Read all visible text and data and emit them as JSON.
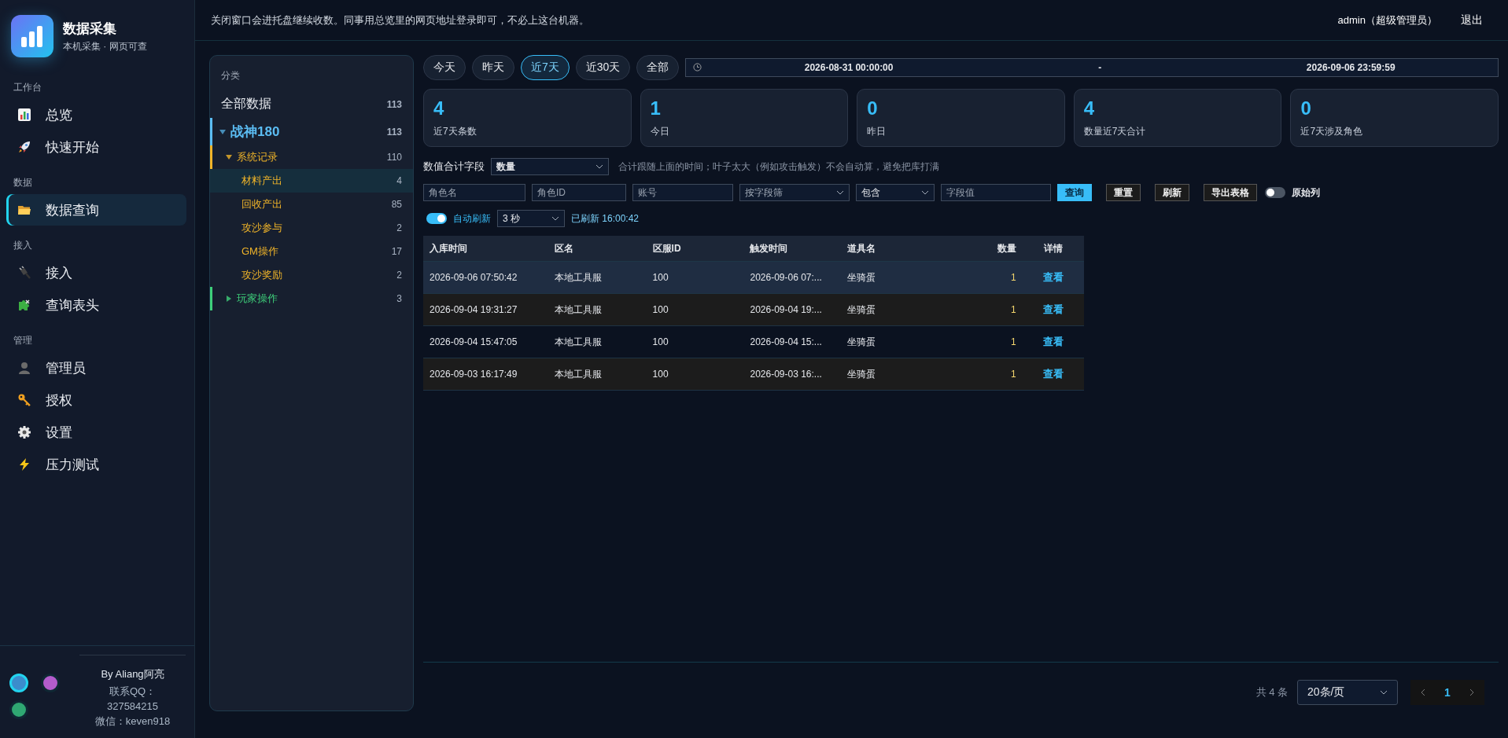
{
  "brand": {
    "title": "数据采集",
    "subtitle": "本机采集 · 网页可查"
  },
  "nav": [
    {
      "section": "工作台",
      "items": [
        {
          "label": "总览",
          "selected": false
        },
        {
          "label": "快速开始",
          "selected": false
        }
      ]
    },
    {
      "section": "数据",
      "items": [
        {
          "label": "数据查询",
          "selected": true
        }
      ]
    },
    {
      "section": "接入",
      "items": [
        {
          "label": "接入",
          "selected": false
        },
        {
          "label": "查询表头",
          "selected": false
        }
      ]
    },
    {
      "section": "管理",
      "items": [
        {
          "label": "管理员",
          "selected": false
        },
        {
          "label": "授权",
          "selected": false
        },
        {
          "label": "设置",
          "selected": false
        },
        {
          "label": "压力测试",
          "selected": false
        }
      ]
    }
  ],
  "themes": [
    {
      "color": "#3b8ccc",
      "selected": true
    },
    {
      "color": "#b35ccc",
      "selected": false
    },
    {
      "color": "#2fa872",
      "selected": false
    }
  ],
  "credits": {
    "author": "By Aliang阿亮",
    "contact_label": "联系QQ：",
    "qq": "327584215",
    "wechat": "微信：keven918"
  },
  "topbar": {
    "notice": "关闭窗口会进托盘继续收数。同事用总览里的网页地址登录即可，不必上这台机器。",
    "user": "admin（超级管理员）",
    "logout": "退出"
  },
  "categories": {
    "title": "分类",
    "items": [
      {
        "label": "全部数据",
        "count": "113",
        "selected": false
      },
      {
        "label": "战神180",
        "count": "113",
        "selected": false,
        "expanded": true,
        "color": "#5bbcf2",
        "children": [
          {
            "label": "系统记录",
            "count": "110",
            "selected": false,
            "expanded": true,
            "color": "#f0b429",
            "children": [
              {
                "label": "材料产出",
                "count": "4",
                "selected": true
              },
              {
                "label": "回收产出",
                "count": "85",
                "selected": false
              },
              {
                "label": "攻沙参与",
                "count": "2",
                "selected": false
              },
              {
                "label": "GM操作",
                "count": "17",
                "selected": false
              },
              {
                "label": "攻沙奖励",
                "count": "2",
                "selected": false
              }
            ]
          },
          {
            "label": "玩家操作",
            "count": "3",
            "selected": false,
            "expanded": false,
            "color": "#3ecf7a"
          }
        ]
      }
    ]
  },
  "date_presets": [
    {
      "label": "今天",
      "selected": false
    },
    {
      "label": "昨天",
      "selected": false
    },
    {
      "label": "近7天",
      "selected": true
    },
    {
      "label": "近30天",
      "selected": false
    },
    {
      "label": "全部",
      "selected": false
    }
  ],
  "date_range": {
    "start": "2026-08-31 00:00:00",
    "separator": "-",
    "end": "2026-09-06 23:59:59"
  },
  "stats": [
    {
      "value": "4",
      "label": "近7天条数"
    },
    {
      "value": "1",
      "label": "今日"
    },
    {
      "value": "0",
      "label": "昨日"
    },
    {
      "value": "4",
      "label": "数量近7天合计"
    },
    {
      "value": "0",
      "label": "近7天涉及角色"
    }
  ],
  "sum_field": {
    "label": "数值合计字段",
    "value": "数量",
    "hint": "合计跟随上面的时间；叶子太大（例如攻击触发）不会自动算，避免把库打满"
  },
  "filters": [
    {
      "kind": "input",
      "placeholder": "角色名"
    },
    {
      "kind": "input",
      "placeholder": "角色ID"
    },
    {
      "kind": "input",
      "placeholder": "账号"
    },
    {
      "kind": "select",
      "placeholder": "按字段筛"
    },
    {
      "kind": "select",
      "value": "包含"
    },
    {
      "kind": "input",
      "placeholder": "字段值"
    },
    {
      "kind": "button",
      "label": "查询",
      "primary": true
    },
    {
      "kind": "button",
      "label": "重置",
      "primary": false
    },
    {
      "kind": "button",
      "label": "刷新",
      "primary": false
    },
    {
      "kind": "button",
      "label": "导出表格",
      "primary": false
    },
    {
      "kind": "toggle",
      "label": "原始列",
      "on": false
    }
  ],
  "auto_refresh": {
    "label": "自动刷新",
    "on": true,
    "interval": "3 秒",
    "status": "已刷新 16:00:42"
  },
  "table": {
    "columns": [
      "入库时间",
      "区名",
      "区服ID",
      "触发时间",
      "道具名",
      "数量",
      "详情"
    ],
    "rows": [
      {
        "cells": [
          "2026-09-06 07:50:42",
          "本地工具服",
          "100",
          "2026-09-06 07:...",
          "坐骑蛋",
          "1"
        ],
        "action": "查看",
        "selected": true
      },
      {
        "cells": [
          "2026-09-04 19:31:27",
          "本地工具服",
          "100",
          "2026-09-04 19:...",
          "坐骑蛋",
          "1"
        ],
        "action": "查看",
        "selected": false
      },
      {
        "cells": [
          "2026-09-04 15:47:05",
          "本地工具服",
          "100",
          "2026-09-04 15:...",
          "坐骑蛋",
          "1"
        ],
        "action": "查看",
        "selected": false
      },
      {
        "cells": [
          "2026-09-03 16:17:49",
          "本地工具服",
          "100",
          "2026-09-03 16:...",
          "坐骑蛋",
          "1"
        ],
        "action": "查看",
        "selected": false
      }
    ]
  },
  "pagination": {
    "total": "共 4 条",
    "page_size": "20条/页",
    "pages": [
      {
        "label": "1",
        "selected": true
      }
    ]
  }
}
